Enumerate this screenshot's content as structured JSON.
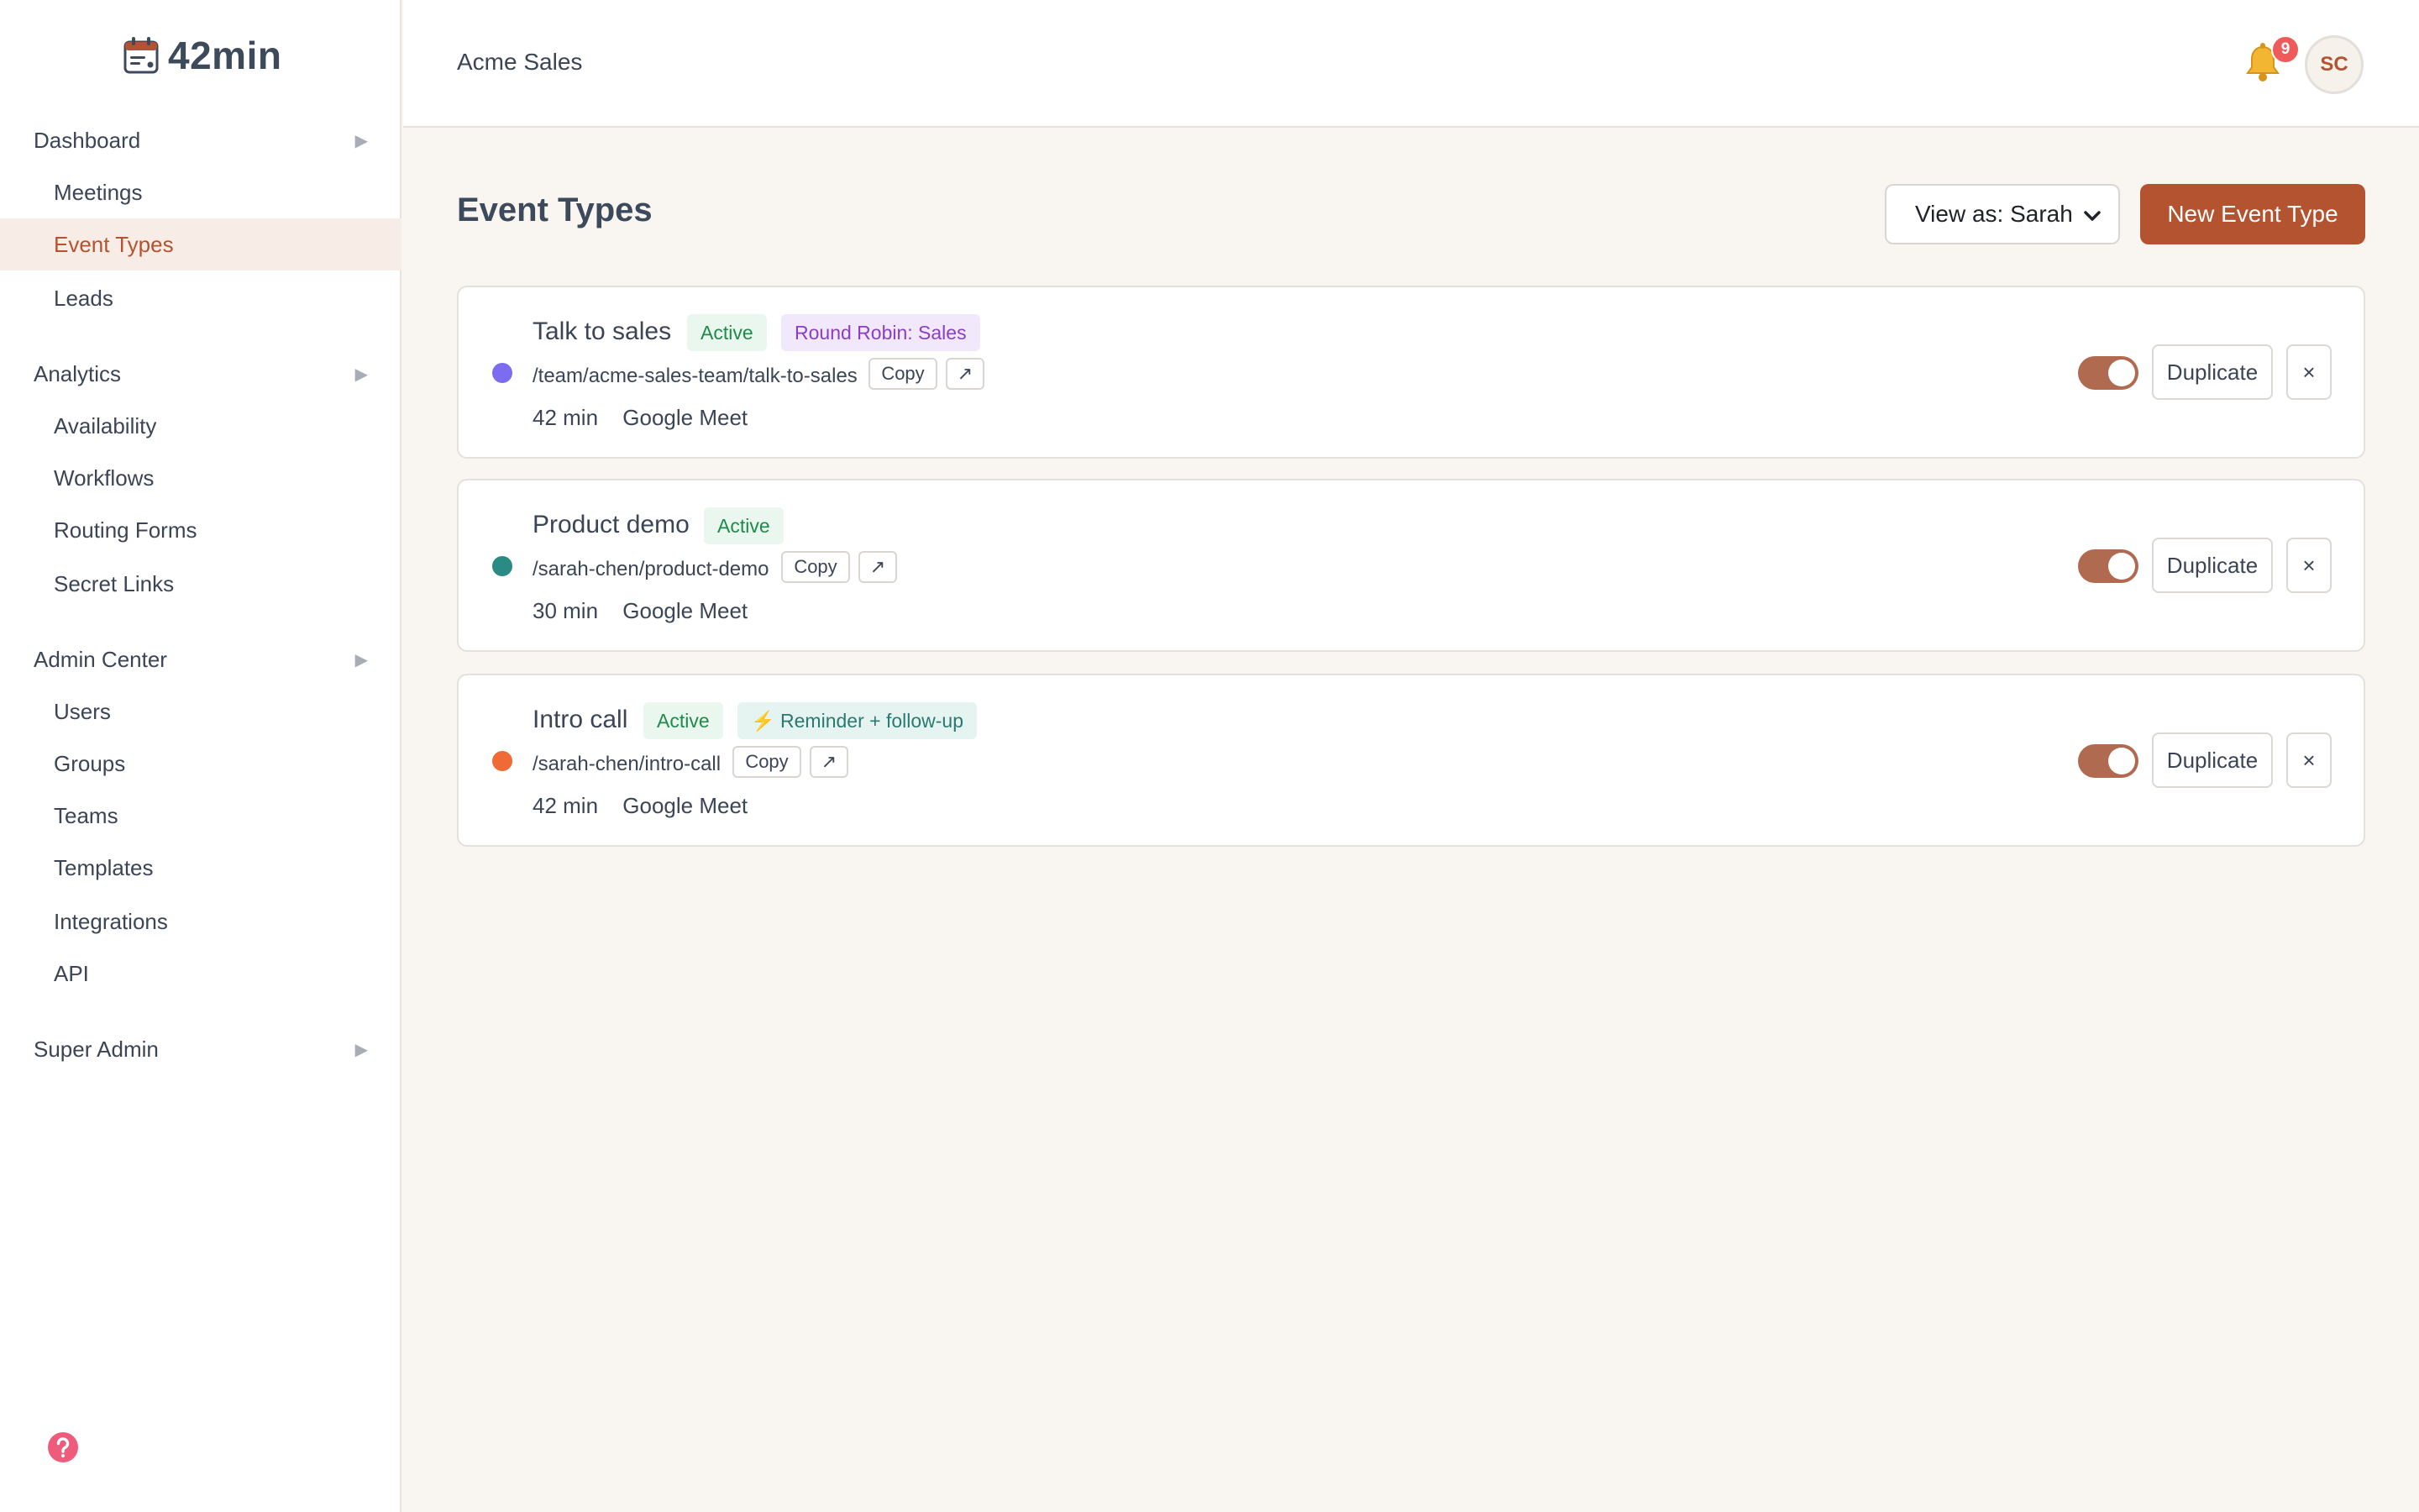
{
  "app": {
    "logo_text": "42min",
    "logo_icon": "calendar-icon"
  },
  "sidebar": {
    "sections": [
      {
        "label": "Dashboard",
        "chevron": "▶",
        "items": [
          {
            "label": "Meetings"
          },
          {
            "label": "Event Types",
            "active": true
          },
          {
            "label": "Leads"
          }
        ]
      },
      {
        "label": "Analytics",
        "chevron": "▶",
        "items": [
          {
            "label": "Availability"
          },
          {
            "label": "Workflows"
          },
          {
            "label": "Routing Forms"
          },
          {
            "label": "Secret Links"
          }
        ]
      },
      {
        "label": "Admin Center",
        "chevron": "▶",
        "items": [
          {
            "label": "Users"
          },
          {
            "label": "Groups"
          },
          {
            "label": "Teams"
          },
          {
            "label": "Templates"
          },
          {
            "label": "Integrations"
          },
          {
            "label": "API"
          }
        ]
      },
      {
        "label": "Super Admin",
        "chevron": "▶",
        "items": []
      }
    ],
    "help_icon": "help-icon"
  },
  "header": {
    "org_name": "Acme Sales",
    "notification_count": "9",
    "avatar_initials": "SC"
  },
  "main": {
    "title": "Event Types",
    "view_as": {
      "selected": "View as: Sarah"
    },
    "new_button": "New Event Type"
  },
  "event_types": [
    {
      "title": "Talk to sales",
      "dot_color": "#7b6cf0",
      "status": "Active",
      "tag": "Round Robin: Sales",
      "tag_kind": "rr",
      "slug": "/team/acme-sales-team/talk-to-sales",
      "copy_label": "Copy",
      "open_label": "↗",
      "duration": "42 min",
      "location": "Google Meet",
      "enabled": true,
      "duplicate_label": "Duplicate",
      "delete_label": "×"
    },
    {
      "title": "Product demo",
      "dot_color": "#2a8a84",
      "status": "Active",
      "tag": "",
      "tag_kind": "",
      "slug": "/sarah-chen/product-demo",
      "copy_label": "Copy",
      "open_label": "↗",
      "duration": "30 min",
      "location": "Google Meet",
      "enabled": true,
      "duplicate_label": "Duplicate",
      "delete_label": "×"
    },
    {
      "title": "Intro call",
      "dot_color": "#f06a35",
      "status": "Active",
      "tag": "⚡ Reminder + follow-up",
      "tag_kind": "wf",
      "slug": "/sarah-chen/intro-call",
      "copy_label": "Copy",
      "open_label": "↗",
      "duration": "42 min",
      "location": "Google Meet",
      "enabled": true,
      "duplicate_label": "Duplicate",
      "delete_label": "×"
    }
  ],
  "colors": {
    "accent": "#b4532f",
    "active_nav_bg": "#f8ede6",
    "page_bg": "#f9f5f0",
    "toggle_on": "#b06a50",
    "badge_red": "#ef5b5b"
  }
}
